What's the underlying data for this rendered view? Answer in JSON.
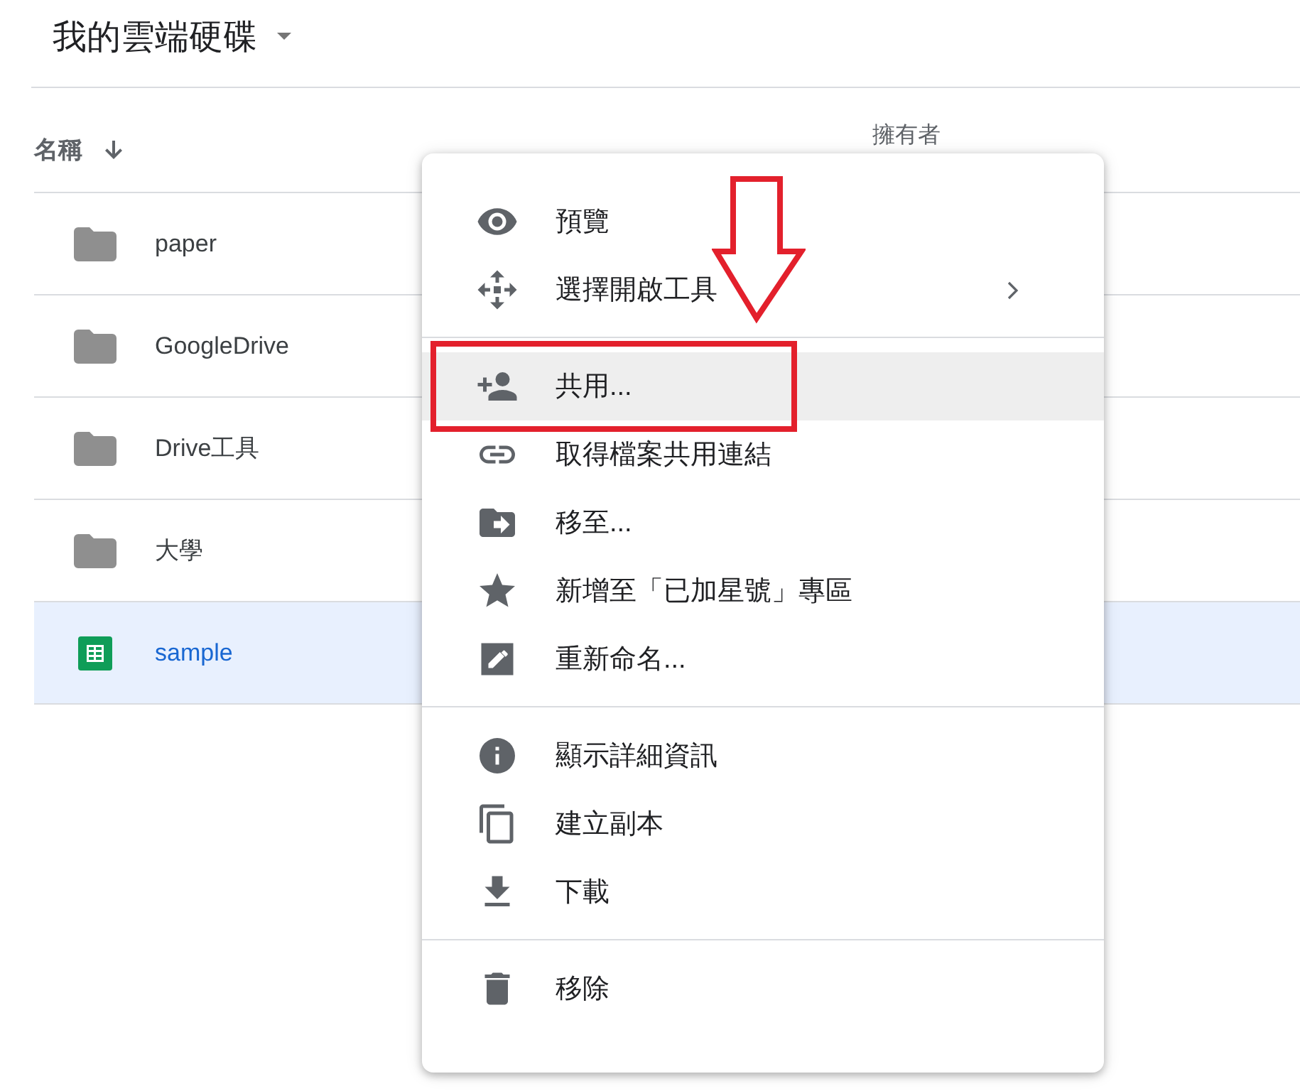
{
  "header": {
    "title": "我的雲端硬碟"
  },
  "columns": [
    {
      "label": "名稱",
      "sorted_descending": true
    },
    {
      "label": "擁有者"
    }
  ],
  "files": [
    {
      "name": "paper",
      "kind": "folder",
      "selected": false
    },
    {
      "name": "GoogleDrive",
      "kind": "folder",
      "selected": false
    },
    {
      "name": "Drive工具",
      "kind": "folder",
      "selected": false
    },
    {
      "name": "大學",
      "kind": "folder",
      "selected": false
    },
    {
      "name": "sample",
      "kind": "spreadsheet",
      "selected": true
    }
  ],
  "context_menu": {
    "groups": [
      [
        {
          "label": "預覽",
          "highlighted": false,
          "submenu": false
        },
        {
          "label": "選擇開啟工具",
          "highlighted": false,
          "submenu": true
        }
      ],
      [
        {
          "label": "共用...",
          "highlighted": true,
          "submenu": false
        },
        {
          "label": "取得檔案共用連結",
          "highlighted": false,
          "submenu": false
        },
        {
          "label": "移至...",
          "highlighted": false,
          "submenu": false
        },
        {
          "label": "新增至「已加星號」專區",
          "highlighted": false,
          "submenu": false
        },
        {
          "label": "重新命名...",
          "highlighted": false,
          "submenu": false
        }
      ],
      [
        {
          "label": "顯示詳細資訊",
          "highlighted": false,
          "submenu": false
        },
        {
          "label": "建立副本",
          "highlighted": false,
          "submenu": false
        },
        {
          "label": "下載",
          "highlighted": false,
          "submenu": false
        }
      ],
      [
        {
          "label": "移除",
          "highlighted": false,
          "submenu": false
        }
      ]
    ]
  }
}
